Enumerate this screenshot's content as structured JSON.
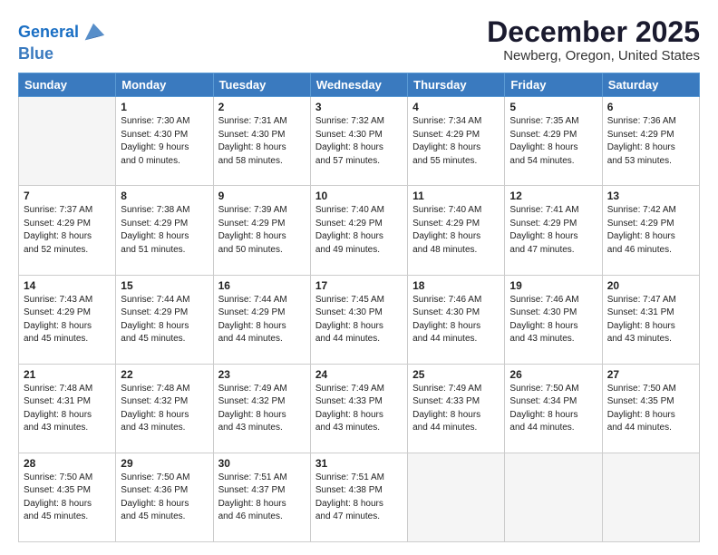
{
  "header": {
    "logo_line1": "General",
    "logo_line2": "Blue",
    "title": "December 2025",
    "subtitle": "Newberg, Oregon, United States"
  },
  "days_of_week": [
    "Sunday",
    "Monday",
    "Tuesday",
    "Wednesday",
    "Thursday",
    "Friday",
    "Saturday"
  ],
  "weeks": [
    [
      {
        "day": "",
        "info": ""
      },
      {
        "day": "1",
        "info": "Sunrise: 7:30 AM\nSunset: 4:30 PM\nDaylight: 9 hours\nand 0 minutes."
      },
      {
        "day": "2",
        "info": "Sunrise: 7:31 AM\nSunset: 4:30 PM\nDaylight: 8 hours\nand 58 minutes."
      },
      {
        "day": "3",
        "info": "Sunrise: 7:32 AM\nSunset: 4:30 PM\nDaylight: 8 hours\nand 57 minutes."
      },
      {
        "day": "4",
        "info": "Sunrise: 7:34 AM\nSunset: 4:29 PM\nDaylight: 8 hours\nand 55 minutes."
      },
      {
        "day": "5",
        "info": "Sunrise: 7:35 AM\nSunset: 4:29 PM\nDaylight: 8 hours\nand 54 minutes."
      },
      {
        "day": "6",
        "info": "Sunrise: 7:36 AM\nSunset: 4:29 PM\nDaylight: 8 hours\nand 53 minutes."
      }
    ],
    [
      {
        "day": "7",
        "info": "Sunrise: 7:37 AM\nSunset: 4:29 PM\nDaylight: 8 hours\nand 52 minutes."
      },
      {
        "day": "8",
        "info": "Sunrise: 7:38 AM\nSunset: 4:29 PM\nDaylight: 8 hours\nand 51 minutes."
      },
      {
        "day": "9",
        "info": "Sunrise: 7:39 AM\nSunset: 4:29 PM\nDaylight: 8 hours\nand 50 minutes."
      },
      {
        "day": "10",
        "info": "Sunrise: 7:40 AM\nSunset: 4:29 PM\nDaylight: 8 hours\nand 49 minutes."
      },
      {
        "day": "11",
        "info": "Sunrise: 7:40 AM\nSunset: 4:29 PM\nDaylight: 8 hours\nand 48 minutes."
      },
      {
        "day": "12",
        "info": "Sunrise: 7:41 AM\nSunset: 4:29 PM\nDaylight: 8 hours\nand 47 minutes."
      },
      {
        "day": "13",
        "info": "Sunrise: 7:42 AM\nSunset: 4:29 PM\nDaylight: 8 hours\nand 46 minutes."
      }
    ],
    [
      {
        "day": "14",
        "info": "Sunrise: 7:43 AM\nSunset: 4:29 PM\nDaylight: 8 hours\nand 45 minutes."
      },
      {
        "day": "15",
        "info": "Sunrise: 7:44 AM\nSunset: 4:29 PM\nDaylight: 8 hours\nand 45 minutes."
      },
      {
        "day": "16",
        "info": "Sunrise: 7:44 AM\nSunset: 4:29 PM\nDaylight: 8 hours\nand 44 minutes."
      },
      {
        "day": "17",
        "info": "Sunrise: 7:45 AM\nSunset: 4:30 PM\nDaylight: 8 hours\nand 44 minutes."
      },
      {
        "day": "18",
        "info": "Sunrise: 7:46 AM\nSunset: 4:30 PM\nDaylight: 8 hours\nand 44 minutes."
      },
      {
        "day": "19",
        "info": "Sunrise: 7:46 AM\nSunset: 4:30 PM\nDaylight: 8 hours\nand 43 minutes."
      },
      {
        "day": "20",
        "info": "Sunrise: 7:47 AM\nSunset: 4:31 PM\nDaylight: 8 hours\nand 43 minutes."
      }
    ],
    [
      {
        "day": "21",
        "info": "Sunrise: 7:48 AM\nSunset: 4:31 PM\nDaylight: 8 hours\nand 43 minutes."
      },
      {
        "day": "22",
        "info": "Sunrise: 7:48 AM\nSunset: 4:32 PM\nDaylight: 8 hours\nand 43 minutes."
      },
      {
        "day": "23",
        "info": "Sunrise: 7:49 AM\nSunset: 4:32 PM\nDaylight: 8 hours\nand 43 minutes."
      },
      {
        "day": "24",
        "info": "Sunrise: 7:49 AM\nSunset: 4:33 PM\nDaylight: 8 hours\nand 43 minutes."
      },
      {
        "day": "25",
        "info": "Sunrise: 7:49 AM\nSunset: 4:33 PM\nDaylight: 8 hours\nand 44 minutes."
      },
      {
        "day": "26",
        "info": "Sunrise: 7:50 AM\nSunset: 4:34 PM\nDaylight: 8 hours\nand 44 minutes."
      },
      {
        "day": "27",
        "info": "Sunrise: 7:50 AM\nSunset: 4:35 PM\nDaylight: 8 hours\nand 44 minutes."
      }
    ],
    [
      {
        "day": "28",
        "info": "Sunrise: 7:50 AM\nSunset: 4:35 PM\nDaylight: 8 hours\nand 45 minutes."
      },
      {
        "day": "29",
        "info": "Sunrise: 7:50 AM\nSunset: 4:36 PM\nDaylight: 8 hours\nand 45 minutes."
      },
      {
        "day": "30",
        "info": "Sunrise: 7:51 AM\nSunset: 4:37 PM\nDaylight: 8 hours\nand 46 minutes."
      },
      {
        "day": "31",
        "info": "Sunrise: 7:51 AM\nSunset: 4:38 PM\nDaylight: 8 hours\nand 47 minutes."
      },
      {
        "day": "",
        "info": ""
      },
      {
        "day": "",
        "info": ""
      },
      {
        "day": "",
        "info": ""
      }
    ]
  ]
}
